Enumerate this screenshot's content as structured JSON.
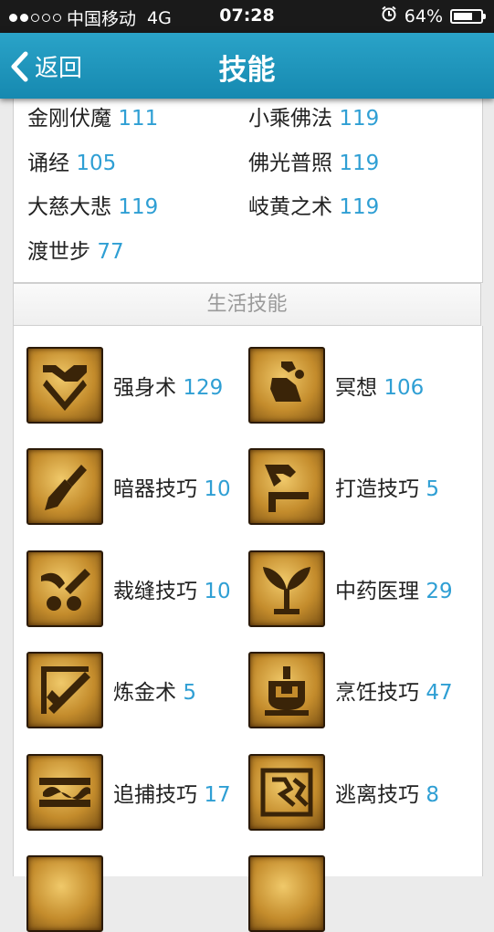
{
  "status_bar": {
    "carrier": "中国移动",
    "network": "4G",
    "time": "07:28",
    "battery": "64%"
  },
  "nav": {
    "back_label": "返回",
    "title": "技能"
  },
  "combat_skills": [
    {
      "name": "金刚伏魔",
      "level": "111"
    },
    {
      "name": "小乘佛法",
      "level": "119"
    },
    {
      "name": "诵经",
      "level": "105"
    },
    {
      "name": "佛光普照",
      "level": "119"
    },
    {
      "name": "大慈大悲",
      "level": "119"
    },
    {
      "name": "岐黄之术",
      "level": "119"
    },
    {
      "name": "渡世步",
      "level": "77"
    }
  ],
  "life_section_title": "生活技能",
  "life_skills": [
    {
      "name": "强身术",
      "level": "129",
      "icon": "strength-icon"
    },
    {
      "name": "冥想",
      "level": "106",
      "icon": "meditation-icon"
    },
    {
      "name": "暗器技巧",
      "level": "10",
      "icon": "dart-icon"
    },
    {
      "name": "打造技巧",
      "level": "5",
      "icon": "forging-hammer-icon"
    },
    {
      "name": "裁缝技巧",
      "level": "10",
      "icon": "scissors-icon"
    },
    {
      "name": "中药医理",
      "level": "29",
      "icon": "herb-icon"
    },
    {
      "name": "炼金术",
      "level": "5",
      "icon": "alchemy-icon"
    },
    {
      "name": "烹饪技巧",
      "level": "47",
      "icon": "cooking-pot-icon"
    },
    {
      "name": "追捕技巧",
      "level": "17",
      "icon": "tracking-icon"
    },
    {
      "name": "逃离技巧",
      "level": "8",
      "icon": "escape-icon"
    }
  ],
  "colors": {
    "nav_bar": "#1f97bf",
    "level_text": "#2f9fd4",
    "section_title": "#9a9a9a",
    "background": "#ebebeb"
  }
}
